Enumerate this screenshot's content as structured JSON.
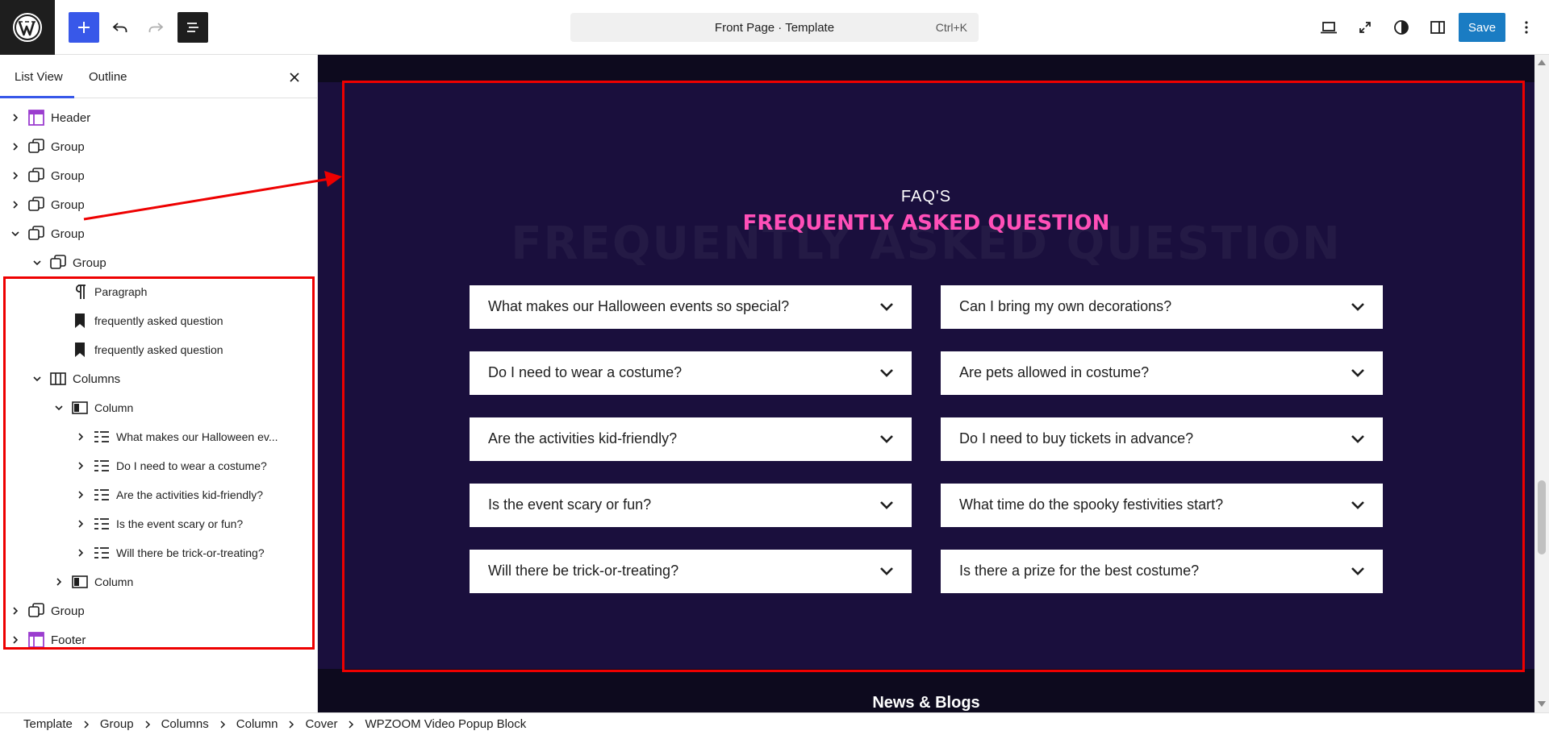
{
  "topbar": {
    "command_title": "Front Page · Template",
    "command_shortcut": "Ctrl+K",
    "save_label": "Save",
    "icons": [
      "wordpress-logo",
      "plus-icon",
      "undo-icon",
      "redo-icon",
      "document-overview-icon",
      "desktop-preview-icon",
      "fullscreen-icon",
      "styles-contrast-icon",
      "sidebar-toggle-icon",
      "more-vertical-icon"
    ],
    "colors": {
      "accent": "#3858e9",
      "save": "#1a7cc3"
    }
  },
  "sidebar": {
    "tab_list": "List View",
    "tab_outline": "Outline",
    "tree": [
      {
        "label": "Header",
        "depth": 0,
        "expanded": false,
        "icon": "template-part-icon"
      },
      {
        "label": "Group",
        "depth": 0,
        "expanded": false,
        "icon": "group-icon"
      },
      {
        "label": "Group",
        "depth": 0,
        "expanded": false,
        "icon": "group-icon"
      },
      {
        "label": "Group",
        "depth": 0,
        "expanded": false,
        "icon": "group-icon"
      },
      {
        "label": "Group",
        "depth": 0,
        "expanded": true,
        "icon": "group-icon"
      },
      {
        "label": "Group",
        "depth": 1,
        "expanded": true,
        "icon": "group-icon"
      },
      {
        "label": "Paragraph",
        "depth": 2,
        "expanded": null,
        "icon": "paragraph-icon"
      },
      {
        "label": "frequently asked question",
        "depth": 2,
        "expanded": null,
        "icon": "bookmark-icon"
      },
      {
        "label": "frequently asked question",
        "depth": 2,
        "expanded": null,
        "icon": "bookmark-icon"
      },
      {
        "label": "Columns",
        "depth": 1,
        "expanded": true,
        "icon": "columns-icon"
      },
      {
        "label": "Column",
        "depth": 2,
        "expanded": true,
        "icon": "column-icon"
      },
      {
        "label": "What makes our Halloween ev...",
        "depth": 3,
        "expanded": false,
        "icon": "accordion-icon"
      },
      {
        "label": "Do I need to wear a costume?",
        "depth": 3,
        "expanded": false,
        "icon": "accordion-icon"
      },
      {
        "label": "Are the activities kid-friendly?",
        "depth": 3,
        "expanded": false,
        "icon": "accordion-icon"
      },
      {
        "label": "Is the event scary or fun?",
        "depth": 3,
        "expanded": false,
        "icon": "accordion-icon"
      },
      {
        "label": "Will there be trick-or-treating?",
        "depth": 3,
        "expanded": false,
        "icon": "accordion-icon"
      },
      {
        "label": "Column",
        "depth": 2,
        "expanded": false,
        "icon": "column-icon"
      },
      {
        "label": "Group",
        "depth": 0,
        "expanded": false,
        "icon": "group-icon"
      },
      {
        "label": "Footer",
        "depth": 0,
        "expanded": false,
        "icon": "template-part-icon"
      }
    ]
  },
  "canvas": {
    "faq_eyebrow": "FAQ'S",
    "faq_heading": "frequently asked question",
    "faq_ghost": "frequently asked question",
    "faq_left": [
      "What makes our Halloween events so special?",
      "Do I need to wear a costume?",
      "Are the activities kid-friendly?",
      "Is the event scary or fun?",
      "Will there be trick-or-treating?"
    ],
    "faq_right": [
      "Can I bring my own decorations?",
      "Are pets allowed in costume?",
      "Do I need to buy tickets in advance?",
      "What time do the spooky festivities start?",
      "Is there a prize for the best costume?"
    ],
    "news_title": "News & Blogs",
    "colors": {
      "section_bg": "#1a0f3d",
      "heading_pink": "#ff4fb8",
      "highlight": "#ee0000"
    }
  },
  "breadcrumb": [
    "Template",
    "Group",
    "Columns",
    "Column",
    "Cover",
    "WPZOOM Video Popup Block"
  ]
}
